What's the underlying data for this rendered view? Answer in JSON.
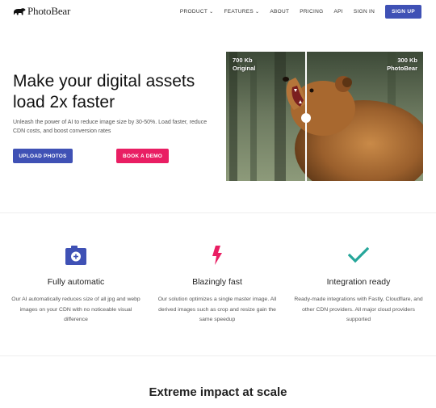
{
  "nav": {
    "brand": "PhotoBear",
    "items": [
      {
        "label": "PRODUCT",
        "dropdown": true
      },
      {
        "label": "FEATURES",
        "dropdown": true
      },
      {
        "label": "ABOUT",
        "dropdown": false
      },
      {
        "label": "PRICING",
        "dropdown": false
      },
      {
        "label": "API",
        "dropdown": false
      },
      {
        "label": "SIGN IN",
        "dropdown": false
      }
    ],
    "signup_label": "SIGN UP"
  },
  "hero": {
    "title": "Make your digital assets load 2x faster",
    "subtitle": "Unleash the power of AI to reduce image size by 30-50%. Load faster, reduce CDN costs, and boost conversion rates",
    "upload_label": "UPLOAD PHOTOS",
    "demo_label": "BOOK A DEMO"
  },
  "compare": {
    "left_size": "700 Kb",
    "left_label": "Original",
    "right_size": "300 Kb",
    "right_label": "PhotoBear"
  },
  "features": [
    {
      "icon": "add-photo-icon",
      "title": "Fully automatic",
      "desc": "Our AI automatically reduces size of all jpg and webp images on your CDN with no noticeable visual difference"
    },
    {
      "icon": "lightning-icon",
      "title": "Blazingly fast",
      "desc": "Our solution optimizes a single master image. All derived images such as crop and resize gain the same speedup"
    },
    {
      "icon": "checkmark-icon",
      "title": "Integration ready",
      "desc": "Ready-made integrations with Fastly, Cloudflare, and other CDN providers. All major cloud providers supported"
    }
  ],
  "impact": {
    "title": "Extreme impact at scale"
  },
  "colors": {
    "primary": "#3f51b5",
    "accent": "#e91e63",
    "check": "#26a69a"
  }
}
